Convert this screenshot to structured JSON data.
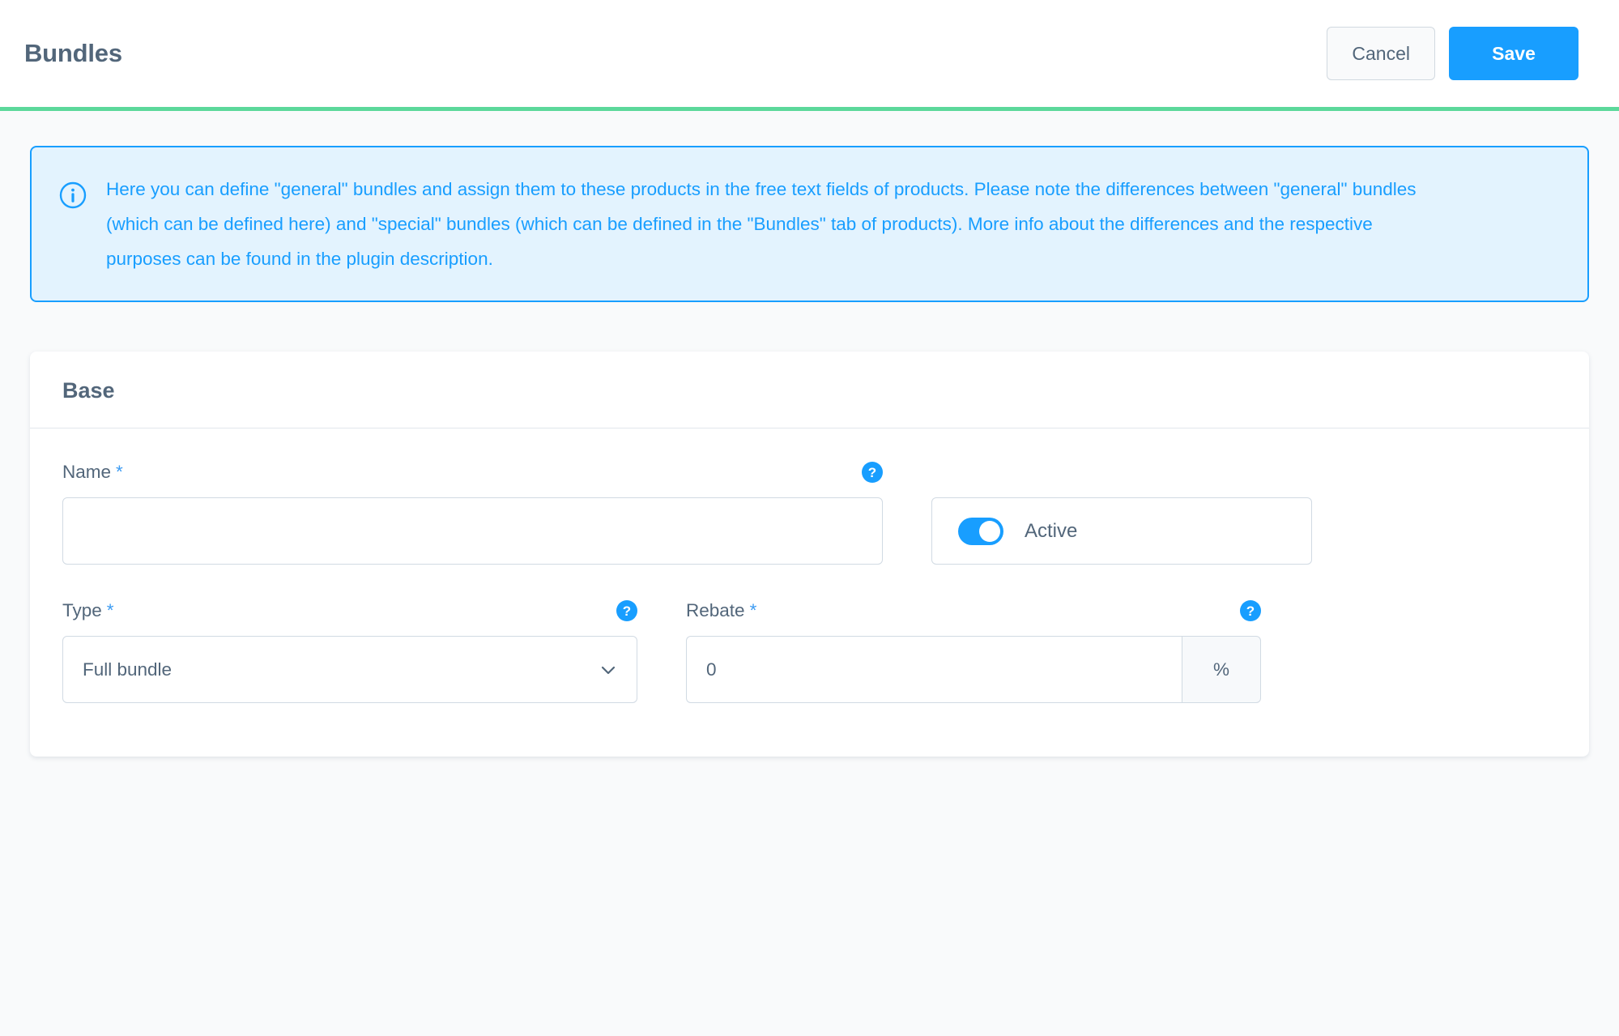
{
  "header": {
    "title": "Bundles",
    "cancel_label": "Cancel",
    "save_label": "Save",
    "accent_color": "#5CD89B"
  },
  "alert": {
    "icon": "info-circle-icon",
    "color": "#189EFF",
    "background": "#E3F3FE",
    "text": "Here you can define \"general\" bundles and assign them to these products in the free text fields of products. Please note the differences between \"general\" bundles (which can be defined here) and \"special\" bundles (which can be defined in the \"Bundles\" tab of products). More info about the differences and the respective purposes can be found in the plugin description."
  },
  "base_card": {
    "title": "Base",
    "fields": {
      "name": {
        "label": "Name",
        "required_marker": "*",
        "value": "",
        "placeholder": "",
        "help_icon": "question-mark-icon"
      },
      "active": {
        "label": "Active",
        "checked": true,
        "accent": "#189EFF"
      },
      "type": {
        "label": "Type",
        "required_marker": "*",
        "value": "Full bundle",
        "help_icon": "question-mark-icon",
        "options": [
          "Full bundle"
        ]
      },
      "rebate": {
        "label": "Rebate",
        "required_marker": "*",
        "value": "0",
        "suffix": "%",
        "help_icon": "question-mark-icon"
      }
    }
  }
}
